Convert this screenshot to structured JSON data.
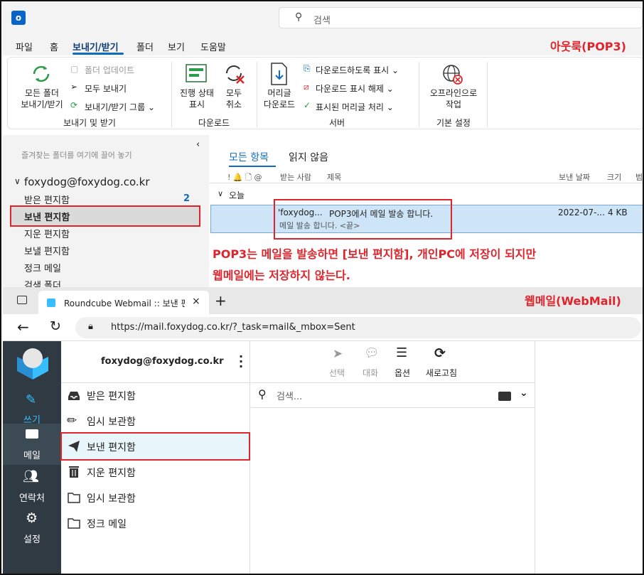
{
  "outlook": {
    "logo_letter": "o",
    "search_placeholder": "검색",
    "menu": [
      "파일",
      "홈",
      "보내기/받기",
      "폴더",
      "보기",
      "도움말"
    ],
    "annotation_label": "아웃룩(POP3)",
    "ribbon": {
      "send_receive_all": [
        "모든 폴더",
        "보내기/받기"
      ],
      "update_folder": "폴더 업데이트",
      "send_all": "모두 보내기",
      "send_receive_groups": "보내기/받기 그룹",
      "group1_label": "보내기 및 받기",
      "progress": [
        "진행 상태",
        "표시"
      ],
      "cancel_all": [
        "모두",
        "취소"
      ],
      "group2_label": "다운로드",
      "download_headers": [
        "머리글",
        "다운로드"
      ],
      "mark_download": "다운로드하도록 표시",
      "unmark_download": "다운로드 표시 해제",
      "process_headers": "표시된 머리글 처리",
      "group3_label": "서버",
      "work_offline": [
        "오프라인으로",
        "작업"
      ],
      "group4_label": "기본 설정"
    },
    "nav": {
      "drag_hint": "즐겨찾는 폴더를 여기에 끌어 놓기",
      "account": "foxydog@foxydog.co.kr",
      "folders": [
        {
          "label": "받은 편지함",
          "count": "2"
        },
        {
          "label": "보낸 편지함"
        },
        {
          "label": "지운 편지함"
        },
        {
          "label": "보낼 편지함"
        },
        {
          "label": "정크 메일"
        },
        {
          "label": "검색 폴더"
        }
      ]
    },
    "list": {
      "tabs": [
        "모든 항목",
        "읽지 않음"
      ],
      "columns": {
        "icons": "! 🔔 🗋 @",
        "from": "받는 사람",
        "subject": "제목",
        "sent": "보낸 날짜",
        "size": "크기",
        "extra": "범"
      },
      "group": "오늘",
      "message": {
        "from": "'foxydog...",
        "subject": "POP3에서 메일 발송 합니다.",
        "preview": "메일 발송 합니다. <끝>",
        "date": "2022-07-...",
        "size": "4 KB"
      }
    },
    "note_line1": "POP3는 메일을 발송하면 [보낸 편지함], 개인PC에 저장이 되지만",
    "note_line2": "웹메일에는 저장하지 않는다."
  },
  "browser": {
    "tab_title": "Roundcube Webmail :: 보낸 편지함",
    "url": "https://mail.foxydog.co.kr/?_task=mail&_mbox=Sent",
    "annotation_label": "웹메일(WebMail)"
  },
  "roundcube": {
    "nav": [
      {
        "label": "쓰기",
        "icon": "compose-icon"
      },
      {
        "label": "메일",
        "icon": "mail-icon"
      },
      {
        "label": "연락처",
        "icon": "contacts-icon"
      },
      {
        "label": "설정",
        "icon": "settings-icon"
      }
    ],
    "account": "foxydog@foxydog.co.kr",
    "folders": [
      {
        "label": "받은 편지함",
        "icon": "inbox-icon"
      },
      {
        "label": "임시 보관함",
        "icon": "pencil-icon"
      },
      {
        "label": "보낸 편지함",
        "icon": "paper-plane-icon"
      },
      {
        "label": "지운 편지함",
        "icon": "trash-icon"
      },
      {
        "label": "임시 보관함",
        "icon": "folder-icon"
      },
      {
        "label": "정크 메일",
        "icon": "folder-icon"
      }
    ],
    "toolbar": [
      "선택",
      "대화",
      "옵션",
      "새로고침"
    ],
    "search_placeholder": "검색..."
  },
  "colors": {
    "accent": "#0f6cbd",
    "annotation": "#e0242b",
    "rc_sidebar": "#2f3a42",
    "selected_row": "#cde5f7"
  }
}
